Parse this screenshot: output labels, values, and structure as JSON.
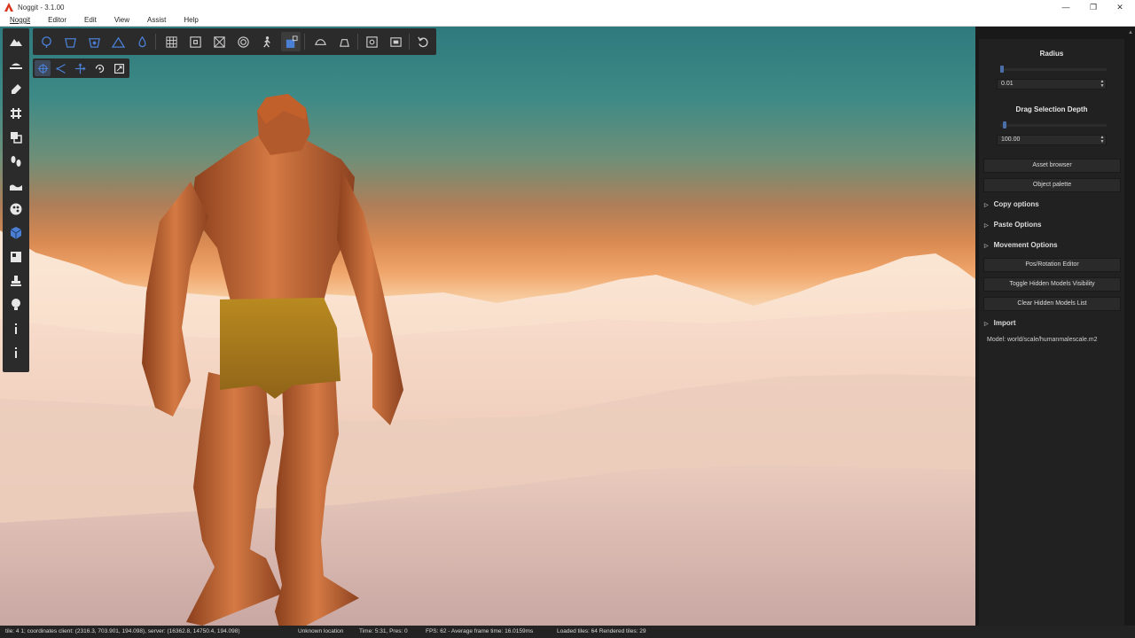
{
  "window": {
    "title": "Noggit - 3.1.00",
    "controls": [
      "—",
      "❐",
      "✕"
    ]
  },
  "menu": [
    "Noggit",
    "Editor",
    "Edit",
    "View",
    "Assist",
    "Help"
  ],
  "left_toolbar": {
    "tools": [
      "raise-lower-icon",
      "flatten-blur-icon",
      "texture-paint-icon",
      "hole-cutter-icon",
      "area-designator-icon",
      "impassible-flag-icon",
      "water-editor-icon",
      "vertex-painter-icon",
      "object-editor-icon",
      "minimap-editor-icon",
      "stamp-icon",
      "light-editor-icon",
      "info-icon",
      "chunk-info-icon"
    ],
    "active_index": 8
  },
  "top_toolbar": {
    "tools": [
      "doodads-icon",
      "wmo-icon",
      "wmo-doodads-icon",
      "terrain-icon",
      "water-icon",
      "grid-icon",
      "chunk-lines-icon",
      "adt-grid-icon",
      "contour-icon",
      "walkable-icon",
      "hidden-models-icon",
      "fog-icon",
      "sky-icon",
      "camera-icon",
      "terrain-preview-icon",
      "undo-icon"
    ],
    "active_index": 10
  },
  "sub_toolbar": {
    "tools": [
      "select-icon",
      "pivot-icon",
      "translate-icon",
      "rotate-icon",
      "scale-icon"
    ],
    "active_index": 0
  },
  "panel": {
    "radius_label": "Radius",
    "radius_value": "0.01",
    "radius_level": 0.0,
    "depth_label": "Drag Selection Depth",
    "depth_value": "100.00",
    "depth_level": 0.03,
    "asset_browser": "Asset browser",
    "object_palette": "Object palette",
    "copy_options": "Copy options",
    "paste_options": "Paste Options",
    "movement_options": "Movement Options",
    "pos_rotation_editor": "Pos/Rotation Editor",
    "toggle_hidden": "Toggle Hidden Models Visibility",
    "clear_hidden": "Clear Hidden Models List",
    "import": "Import",
    "model_text": "Model: world/scale/humanmalescale.m2"
  },
  "status": {
    "tile": "tile: 4 1; coordinates client: (2316.3, 703.901, 194.098), server: (16362.8, 14750.4, 194.098)",
    "location": "Unknown location",
    "time": "Time: 5:31, Pres: 0",
    "fps": "FPS: 62 - Average frame time: 16.0159ms",
    "tiles": "Loaded tiles: 64 Rendered tiles: 29"
  },
  "colors": {
    "accent": "#4a7fd4",
    "panel_bg": "#212121",
    "toolbar_bg": "#2b2b2b",
    "logo": "#d9341c"
  }
}
